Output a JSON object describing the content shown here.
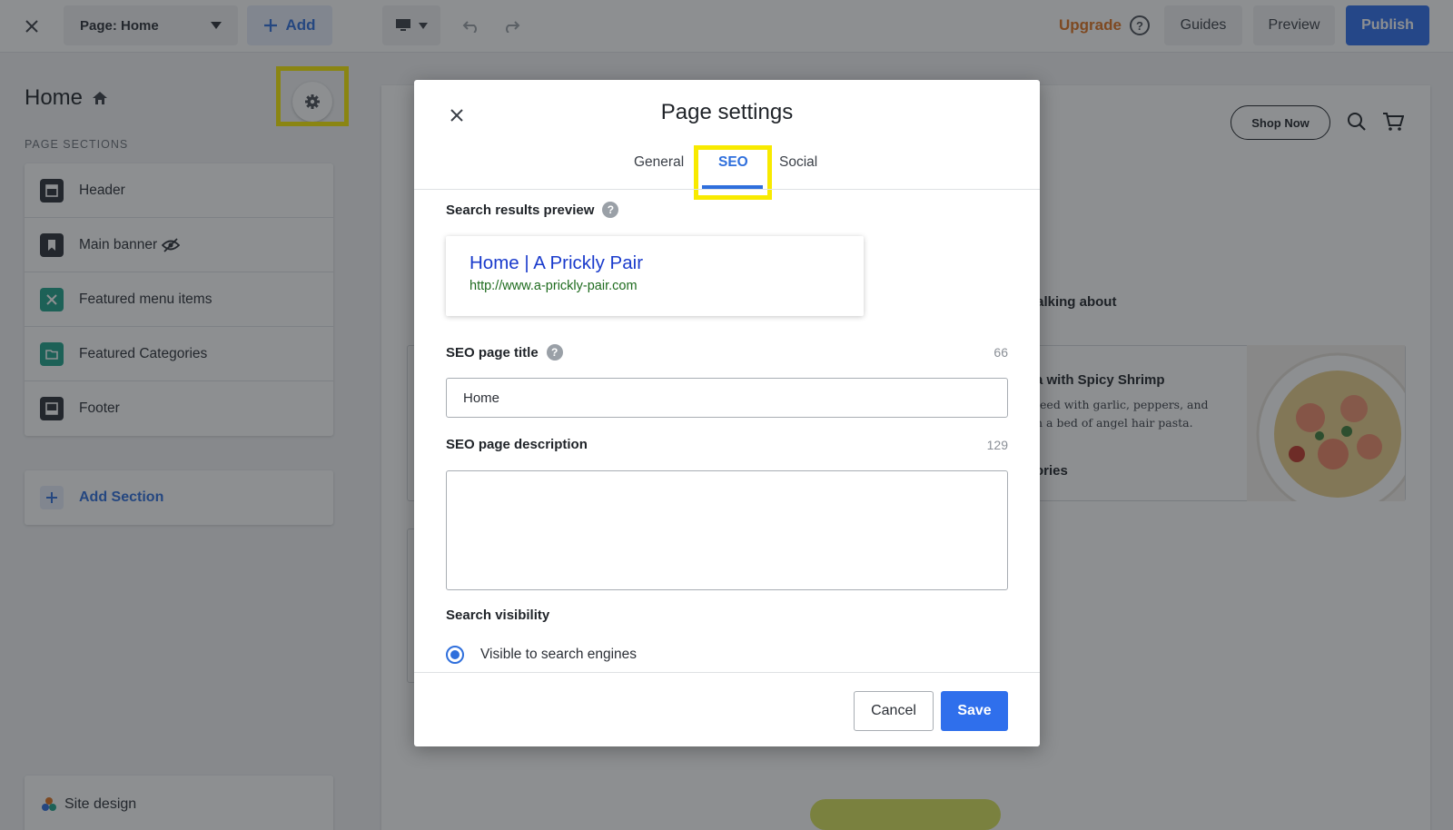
{
  "topbar": {
    "page_select": "Page: Home",
    "add_label": "Add",
    "upgrade_label": "Upgrade",
    "help_icon": "?",
    "guides_label": "Guides",
    "preview_label": "Preview",
    "publish_label": "Publish"
  },
  "sidebar": {
    "title": "Home",
    "caption": "PAGE SECTIONS",
    "sections": [
      {
        "label": "Header",
        "icon": "header-section-icon",
        "color": "#2b2f36"
      },
      {
        "label": "Main banner",
        "icon": "banner-section-icon",
        "color": "#2b2f36"
      },
      {
        "label": "Featured menu items",
        "icon": "menu-items-section-icon",
        "color": "#1fa38a"
      },
      {
        "label": "Featured Categories",
        "icon": "folder-section-icon",
        "color": "#1fa38a"
      },
      {
        "label": "Footer",
        "icon": "footer-section-icon",
        "color": "#2b2f36"
      }
    ],
    "add_section": "Add Section",
    "site_design": "Site design"
  },
  "canvas": {
    "shop_now": "Shop Now",
    "talking_about": "’s talking about",
    "card_title": "a with Spicy Shrimp",
    "card_desc_1": "teed with garlic, peppers, and",
    "card_desc_2": "n a bed of angel hair pasta.",
    "card_link": "ories"
  },
  "modal": {
    "title": "Page settings",
    "tabs": [
      "General",
      "SEO",
      "Social"
    ],
    "active_tab": "SEO",
    "search_preview_label": "Search results preview",
    "help_glyph": "?",
    "serp_title": "Home | A Prickly Pair",
    "serp_url": "http://www.a-prickly-pair.com",
    "seo_title_label": "SEO page title",
    "seo_title_count": "66",
    "seo_title_value": "Home",
    "seo_desc_label": "SEO page description",
    "seo_desc_count": "129",
    "seo_desc_value": "",
    "visibility_label": "Search visibility",
    "visibility_option": "Visible to search engines",
    "cancel_label": "Cancel",
    "save_label": "Save"
  },
  "colors": {
    "accent": "#2f6fec",
    "upgrade": "#e0731f",
    "highlight": "#f8ea00",
    "serp_title": "#1a3bcc",
    "serp_url": "#1e6b1e"
  }
}
